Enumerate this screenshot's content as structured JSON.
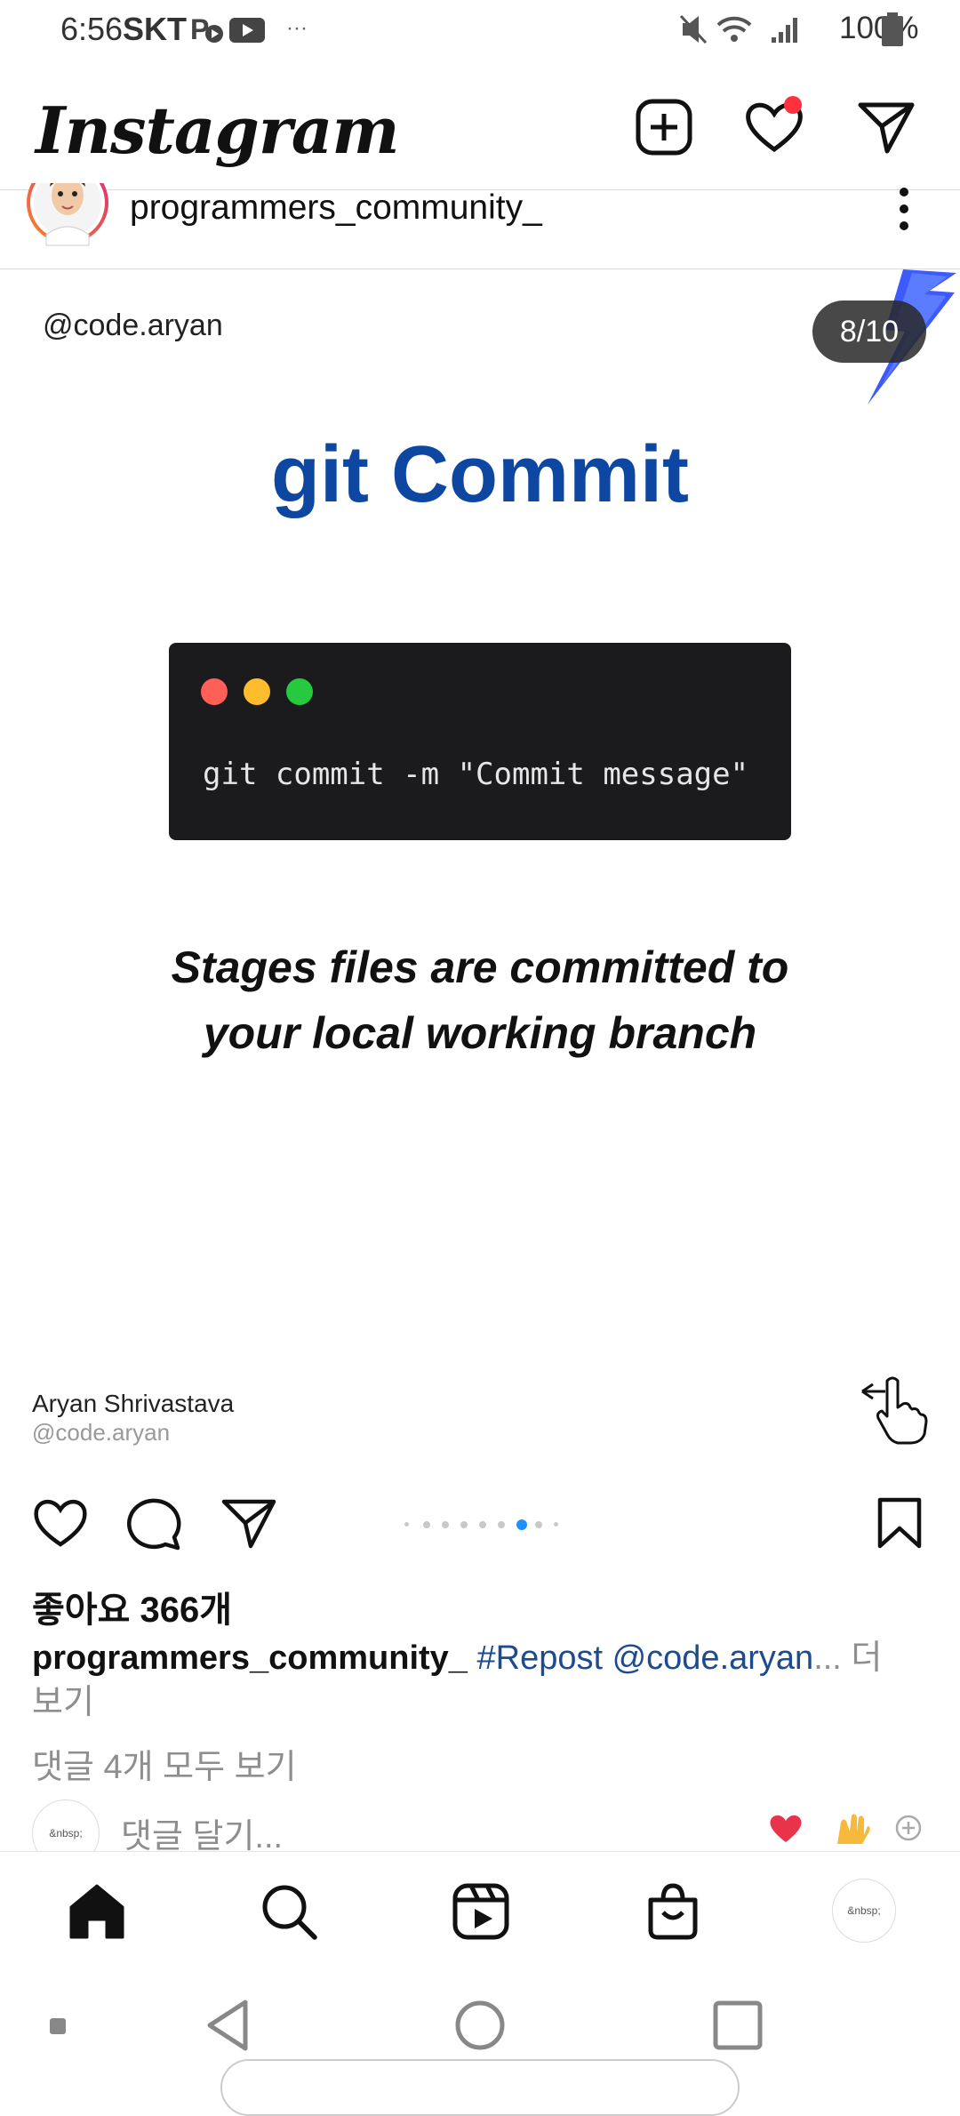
{
  "status_bar": {
    "time": "6:56",
    "carrier": "SKT",
    "battery": "100%"
  },
  "header": {
    "logo": "Instagram"
  },
  "post": {
    "username": "programmers_community_",
    "slide": {
      "handle": "@code.aryan",
      "counter": "8/10",
      "title": "git Commit",
      "code": "git commit -m \"Commit message\"",
      "description": "Stages files are committed to your local working branch",
      "author_name": "Aryan Shrivastava",
      "author_handle": "@code.aryan"
    },
    "likes": "좋아요 366개",
    "caption_user": "programmers_community_",
    "caption_tags": "#Repost @code.aryan",
    "caption_ellipsis": "...",
    "caption_more": " 더 보기",
    "view_comments": "댓글 4개 모두 보기",
    "comment_placeholder": "댓글 달기...",
    "avatar_text": "&nbsp;",
    "carousel_total": 9,
    "carousel_active_index": 6
  },
  "colors": {
    "title_blue": "#0d47a1",
    "notification_dot": "#ff3040",
    "carousel_active": "#1e90ff",
    "code_bg": "#1b1b1d"
  },
  "icons": {
    "header": [
      "new-post-icon",
      "heart-icon",
      "direct-message-icon"
    ],
    "actions": [
      "like-icon",
      "comment-icon",
      "share-icon",
      "bookmark-icon"
    ],
    "nav": [
      "home-icon",
      "search-icon",
      "reels-icon",
      "shop-icon",
      "profile-avatar"
    ],
    "system": [
      "back-icon",
      "home-circle-icon",
      "recents-icon"
    ]
  }
}
